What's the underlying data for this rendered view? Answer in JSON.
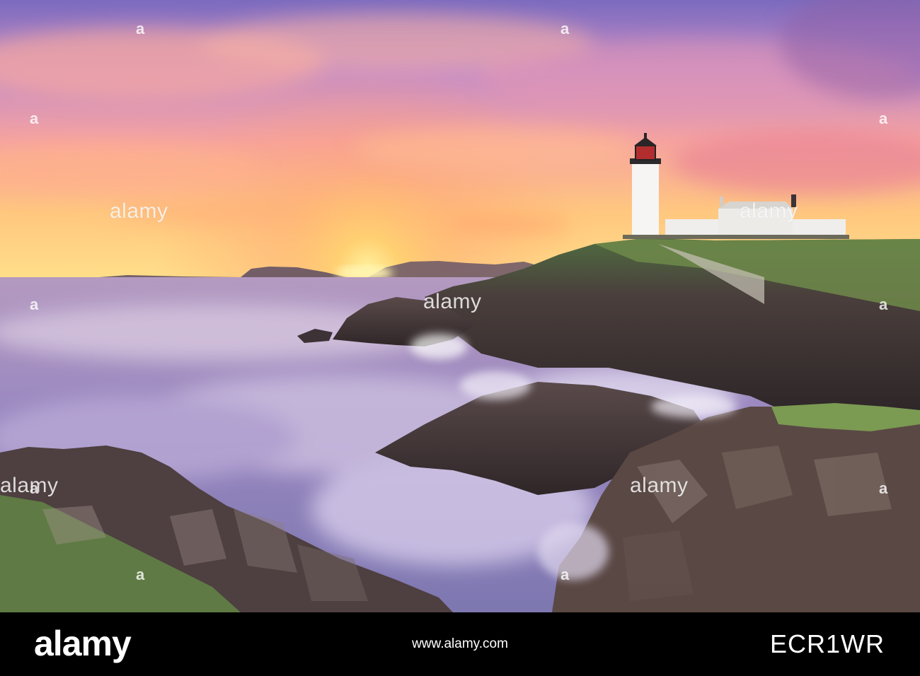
{
  "watermark": {
    "label": "alamy",
    "letter": "a"
  },
  "footer": {
    "brand": "alamy",
    "url": "www.alamy.com",
    "image_id": "ECR1WR"
  },
  "colors": {
    "sky_top": "#8a6fbf",
    "sky_glow": "#ffb070",
    "sun": "#ffd36a",
    "sea": "#a89ac8",
    "rock": "#4a3a3e",
    "grass": "#6f8a4a",
    "lighthouse": "#f4f2f0",
    "footer_bg": "#000000"
  }
}
